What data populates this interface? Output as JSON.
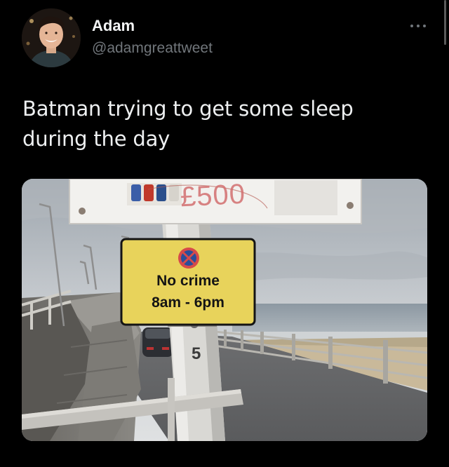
{
  "author": {
    "name": "Adam",
    "handle": "@adamgreattweet",
    "avatar_icon": "profile-photo"
  },
  "menu": {
    "more_icon": "more-horizontal-icon"
  },
  "tweet": {
    "text_line1": "Batman trying to get some sleep",
    "text_line2": "during the day"
  },
  "photo": {
    "sign_line1": "No crime",
    "sign_line2": "8am - 6pm",
    "price": "£500",
    "post_number": "5"
  },
  "colors": {
    "background": "#000000",
    "name": "#f3f4f5",
    "handle": "#71767b",
    "sign_yellow": "#e8d35b"
  }
}
